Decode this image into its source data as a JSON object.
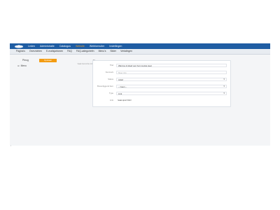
{
  "topnav": {
    "items": [
      {
        "label": "Leden",
        "active": false
      },
      {
        "label": "Administratie",
        "active": false
      },
      {
        "label": "Catalogus",
        "active": false
      },
      {
        "label": "Website",
        "active": true
      },
      {
        "label": "Webformulier",
        "active": false
      },
      {
        "label": "Instellingen",
        "active": false
      }
    ],
    "logo_icon": "home-cloud-icon",
    "bg_color": "#1f5da3",
    "active_color": "#f0a030"
  },
  "subnav": {
    "items": [
      "Pagina's",
      "Overzichten",
      "E-mailsjablonen",
      "FAQ",
      "FAQ-categorieën",
      "Menu's",
      "Slider",
      "Vertalingen"
    ]
  },
  "left": {
    "label": "Pbrug",
    "button_label": "Opslaan",
    "button_color": "#f39c12",
    "tree_item": "Menu",
    "tree_icon": "expand-icon"
  },
  "section": {
    "title": "Menu",
    "subtitle": "Vaak bezochte info pagina"
  },
  "form": {
    "fields": [
      {
        "label": "Titel",
        "value": "Wat doe ik ideal voor het mooiste weer",
        "type": "text"
      },
      {
        "label": "Kenmerk",
        "value": "",
        "placeholder": "Meer info",
        "type": "text"
      },
      {
        "label": "Status",
        "value": "Actief",
        "type": "select"
      },
      {
        "label": "Bovenliggend item",
        "value": "-- Geen --",
        "type": "select"
      },
      {
        "label": "Type",
        "value": "Link",
        "type": "select"
      },
      {
        "label": "Link",
        "value": "/vaar-sport.html",
        "type": "plain"
      }
    ]
  },
  "footer": {
    "text": "•"
  }
}
